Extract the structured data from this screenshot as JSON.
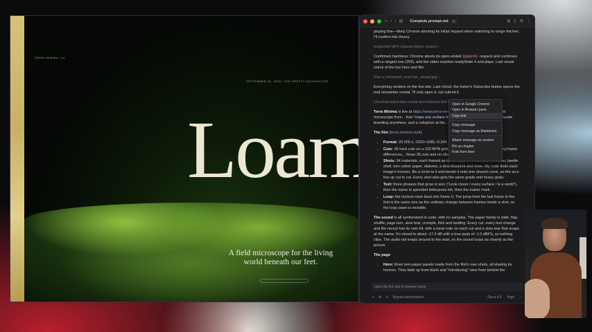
{
  "preview": {
    "hero_word": "Loam",
    "tagline": "A field microscope for the living world beneath our feet.",
    "top_small_label": "SEPTEMBER 03, 2026 / THE PRETTY MICROSCOPE",
    "left_small_label": "TERRA MINIMA / 01"
  },
  "window": {
    "title": "Complete prompt.md",
    "title_badge": "",
    "lines": {
      "l1": "playing fine—likely Chrome aborting its initial request when switching to range fetches. I'll confirm this theory.",
      "l2": "Inspected MP4 request failure reason",
      "l3a": "Confirmed harmless: Chrome aborts its open-ended ",
      "l3code": "bytes=0-",
      "l3b": " request and continues with a ranged one (206), and the video reaches readyState 4 and plays. Last visual check of the live hero and film",
      "l4": "Ran a command, read live_ahead.jpg",
      "l5": "Everything renders on the live site. Last check: the footer's Subscribe button opens the real newsletter modal. I'll only open it, not submit it.",
      "l6": "Checked subscribe modal and followed link live",
      "p1_bold": "Terra Minima",
      "p1_a": " is live at ",
      "p1_link": "https://www.terra-minima.app",
      "p1_b": " It's a fictional pocket field microscope from... that \"maps any surface the way orbiters map planets\"... Claude branding anywhere, and a colophon at the... is invented.",
      "film_head": "The film",
      "film_link": "terra-minima.mp4",
      "film_items": [
        {
          "b": "Format:",
          "t": " 20.000 s, 1920×1080, H.264"
        },
        {
          "b": "Cuts:",
          "t": " 35 hard cuts on a 120 BPM grid... speeding up to 0.25 s. Checking frame differences... those 35 cuts and no others."
        },
        {
          "b": "Shots:",
          "t": " 34 materials, each framed as its own planet: moss, pollen, lichen, beetle shell, torn cotton paper, diatoms, a lens blueprint and more. My code finds each image's horizon, fits a circle to it and bends it onto one shared curve, so the arcs line up cut to cut. Every shot also gets the same grade and heavy grain."
        },
        {
          "b": "Text:",
          "t": " three phrases that grow in size (\"Look closer / every surface / is a world\"), then the name in speckled letterpress ink, then the maker mark."
        },
        {
          "b": "Loop:",
          "t": " the horizon rises back into frame 0. The jump from the last frame to the first is the same size as the ordinary change between frames inside a shot, so the loop seam is invisible."
        }
      ],
      "sound": "The sound",
      "sound_t": " is all synthesised in code, with no samples. The paper family is slide, flap, shuffle, page turn, slow tear, crumple, flick and landing. Every cut, every text change and the reveal has its own hit, with a tonal note on each cut and a slow tear that snaps at the name. It's mixed to about -17.5 dB with a true peak of -1.0 dBFS, so nothing clips. The audio tail wraps around to the start, so the sound loops as cleanly as the picture.",
      "page_head": "The page",
      "hero_b": "Hero:",
      "hero_t": " three torn-paper panels made from the film's own shots, all sharing its horizon. They fade up from black and \"introducing\" view from behind the"
    },
    "input_placeholder": "open the live site in browser pane",
    "status": {
      "bypass": "Bypass permissions",
      "model": "Opus 4.5",
      "effort": "High"
    }
  },
  "context_menu": {
    "items": [
      "Open in Google Chrome",
      "Open in Browser pane",
      "Copy link",
      "Copy message",
      "Copy message as Markdown",
      "Attach message as context",
      "Pin as chapter",
      "Fork from here"
    ]
  },
  "colors": {
    "accent_link": "#7fa8e0",
    "code_pink": "#e8768a",
    "traffic_red": "#ff5f57",
    "traffic_yellow": "#febc2e",
    "traffic_green": "#28c840"
  }
}
